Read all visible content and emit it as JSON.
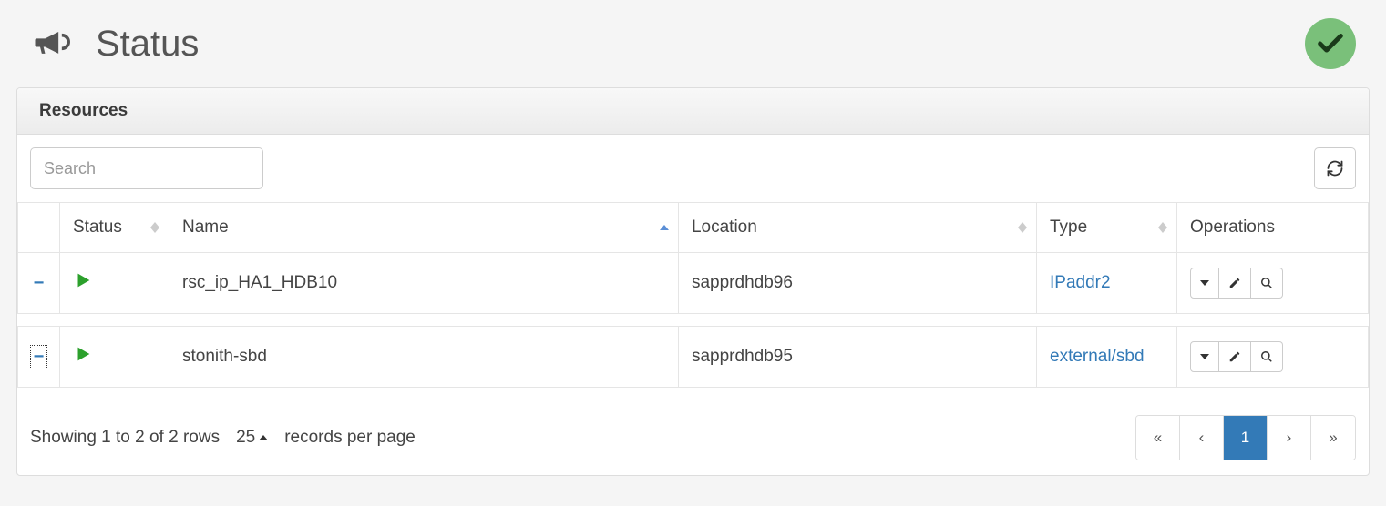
{
  "page": {
    "title": "Status"
  },
  "panel": {
    "heading": "Resources"
  },
  "search": {
    "placeholder": "Search",
    "value": ""
  },
  "columns": {
    "status": "Status",
    "name": "Name",
    "location": "Location",
    "type": "Type",
    "operations": "Operations"
  },
  "rows": [
    {
      "name": "rsc_ip_HA1_HDB10",
      "location": "sapprdhdb96",
      "type": "IPaddr2"
    },
    {
      "name": "stonith-sbd",
      "location": "sapprdhdb95",
      "type": "external/sbd"
    }
  ],
  "footer": {
    "summary": "Showing 1 to 2 of 2 rows",
    "page_size": "25",
    "records_label": "records per page"
  },
  "pagination": {
    "first": "«",
    "prev": "‹",
    "current": "1",
    "next": "›",
    "last": "»"
  }
}
